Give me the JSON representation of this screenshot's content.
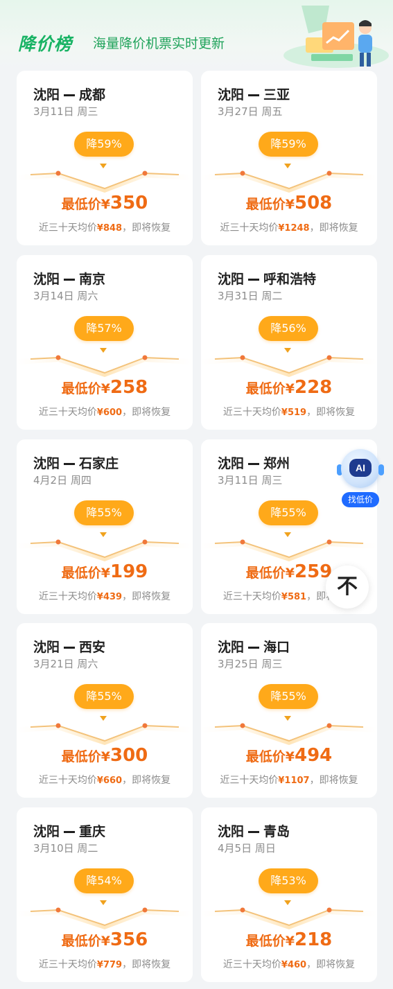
{
  "header": {
    "brand": "降价榜",
    "slogan": "海量降价机票实时更新"
  },
  "colors": {
    "brand_green": "#18b364",
    "badge_orange": "#ffa91a",
    "price_orange": "#ef6b14"
  },
  "cards": [
    {
      "from": "沈阳",
      "to": "成都",
      "date": "3月11日 周三",
      "discount": "降59%",
      "price_label": "最低价",
      "currency": "¥",
      "price": "350",
      "avg_prefix": "近三十天均价",
      "avg_price": "¥848",
      "avg_suffix": "，即将恢复"
    },
    {
      "from": "沈阳",
      "to": "三亚",
      "date": "3月27日 周五",
      "discount": "降59%",
      "price_label": "最低价",
      "currency": "¥",
      "price": "508",
      "avg_prefix": "近三十天均价",
      "avg_price": "¥1248",
      "avg_suffix": "，即将恢复"
    },
    {
      "from": "沈阳",
      "to": "南京",
      "date": "3月14日 周六",
      "discount": "降57%",
      "price_label": "最低价",
      "currency": "¥",
      "price": "258",
      "avg_prefix": "近三十天均价",
      "avg_price": "¥600",
      "avg_suffix": "，即将恢复"
    },
    {
      "from": "沈阳",
      "to": "呼和浩特",
      "date": "3月31日 周二",
      "discount": "降56%",
      "price_label": "最低价",
      "currency": "¥",
      "price": "228",
      "avg_prefix": "近三十天均价",
      "avg_price": "¥519",
      "avg_suffix": "，即将恢复"
    },
    {
      "from": "沈阳",
      "to": "石家庄",
      "date": "4月2日 周四",
      "discount": "降55%",
      "price_label": "最低价",
      "currency": "¥",
      "price": "199",
      "avg_prefix": "近三十天均价",
      "avg_price": "¥439",
      "avg_suffix": "，即将恢复"
    },
    {
      "from": "沈阳",
      "to": "郑州",
      "date": "3月11日 周三",
      "discount": "降55%",
      "price_label": "最低价",
      "currency": "¥",
      "price": "259",
      "avg_prefix": "近三十天均价",
      "avg_price": "¥581",
      "avg_suffix": "，即将恢复"
    },
    {
      "from": "沈阳",
      "to": "西安",
      "date": "3月21日 周六",
      "discount": "降55%",
      "price_label": "最低价",
      "currency": "¥",
      "price": "300",
      "avg_prefix": "近三十天均价",
      "avg_price": "¥660",
      "avg_suffix": "，即将恢复"
    },
    {
      "from": "沈阳",
      "to": "海口",
      "date": "3月25日 周三",
      "discount": "降55%",
      "price_label": "最低价",
      "currency": "¥",
      "price": "494",
      "avg_prefix": "近三十天均价",
      "avg_price": "¥1107",
      "avg_suffix": "，即将恢复"
    },
    {
      "from": "沈阳",
      "to": "重庆",
      "date": "3月10日 周二",
      "discount": "降54%",
      "price_label": "最低价",
      "currency": "¥",
      "price": "356",
      "avg_prefix": "近三十天均价",
      "avg_price": "¥779",
      "avg_suffix": "，即将恢复"
    },
    {
      "from": "沈阳",
      "to": "青岛",
      "date": "4月5日 周日",
      "discount": "降53%",
      "price_label": "最低价",
      "currency": "¥",
      "price": "218",
      "avg_prefix": "近三十天均价",
      "avg_price": "¥460",
      "avg_suffix": "，即将恢复"
    }
  ],
  "ai_assistant": {
    "screen_text": "AI",
    "label": "找低价"
  },
  "back_to_top": {
    "glyph": "不"
  }
}
